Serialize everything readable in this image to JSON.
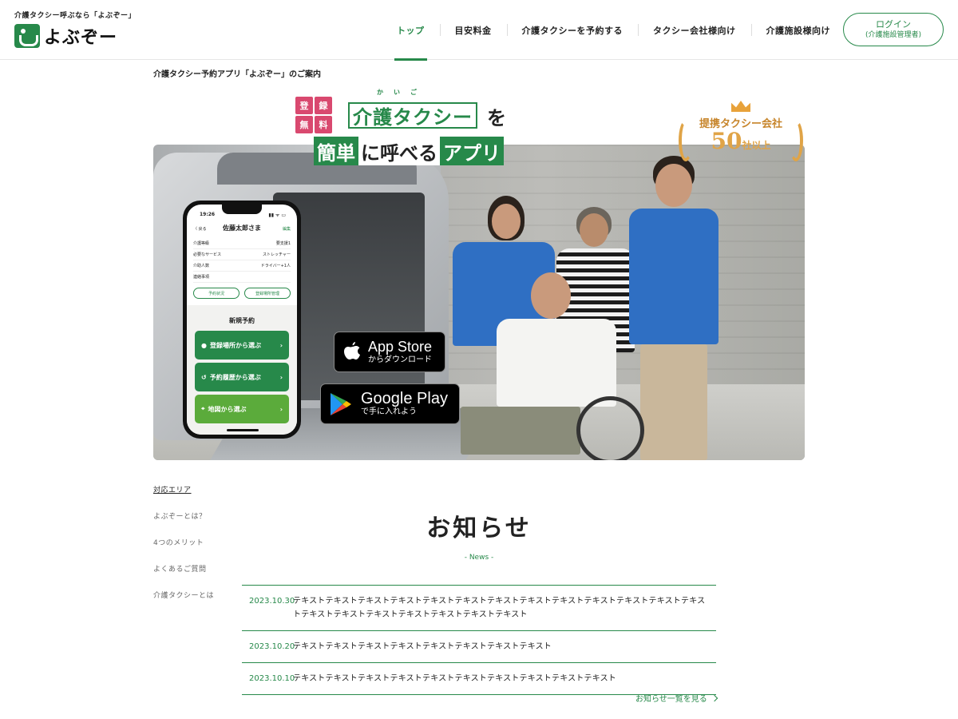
{
  "header": {
    "tagline": "介護タクシー呼ぶなら「よぶぞー」",
    "logo_text": "よぶぞー",
    "nav": [
      {
        "label": "トップ",
        "active": true
      },
      {
        "label": "目安料金",
        "active": false
      },
      {
        "label": "介護タクシーを予約する",
        "active": false
      },
      {
        "label": "タクシー会社様向け",
        "active": false
      },
      {
        "label": "介護施設様向け",
        "active": false
      }
    ],
    "login": {
      "label": "ログイン",
      "sub": "(介護施設管理者)"
    }
  },
  "breadcrumb": "介護タクシー予約アプリ「よぶぞー」のご案内",
  "hero": {
    "free_badge": [
      "登",
      "録",
      "無",
      "料"
    ],
    "ruby": "かいご",
    "headline1": "介護タクシー",
    "headline1_suffix": "を",
    "headline2": [
      {
        "text": "簡単",
        "highlight": true
      },
      {
        "text": "に呼べる",
        "highlight": false
      },
      {
        "text": "アプリ",
        "highlight": true
      }
    ],
    "award": {
      "line1": "提携タクシー会社",
      "number": "50",
      "unit": "社以上"
    },
    "phone": {
      "time": "19:26",
      "status": "▮▮ ᯤ ▭",
      "back": "〈 戻る",
      "name": "佐藤太郎さま",
      "edit": "編集",
      "rows": [
        {
          "label": "介護等級",
          "value": "要支援1"
        },
        {
          "label": "必要なサービス",
          "value": "ストレッチャー"
        },
        {
          "label": "介助人数",
          "value": "ドライバー+1人"
        },
        {
          "label": "連絡事項",
          "value": ""
        }
      ],
      "pills": [
        "予約状況",
        "登録場所管理"
      ],
      "new_reservation": "新規予約",
      "buttons": [
        {
          "label": "登録場所から選ぶ",
          "icon": "pin-icon"
        },
        {
          "label": "予約履歴から選ぶ",
          "icon": "history-icon"
        },
        {
          "label": "地図から選ぶ",
          "icon": "map-icon"
        }
      ]
    },
    "app_store": {
      "main": "App Store",
      "sub": "からダウンロード"
    },
    "google_play": {
      "main": "Google Play",
      "sub": "で手に入れよう"
    }
  },
  "side_nav": [
    "対応エリア",
    "よぶぞーとは？",
    "4つのメリット",
    "よくあるご質問",
    "介護タクシーとは"
  ],
  "news": {
    "title": "お知らせ",
    "subtitle": "- News -",
    "items": [
      {
        "date": "2023.10.30",
        "text": "テキストテキストテキストテキストテキストテキストテキストテキストテキストテキストテキストテキストテキストテキストテキストテキストテキストテキストテキストテキスト"
      },
      {
        "date": "2023.10.20",
        "text": "テキストテキストテキストテキストテキストテキストテキストテキスト"
      },
      {
        "date": "2023.10.10",
        "text": "テキストテキストテキストテキストテキストテキストテキストテキストテキストテキスト"
      }
    ],
    "more": "お知らせ一覧を見る"
  },
  "colors": {
    "brand": "#27894a",
    "accent_pink": "#d9496f",
    "gold": "#e0a447"
  }
}
